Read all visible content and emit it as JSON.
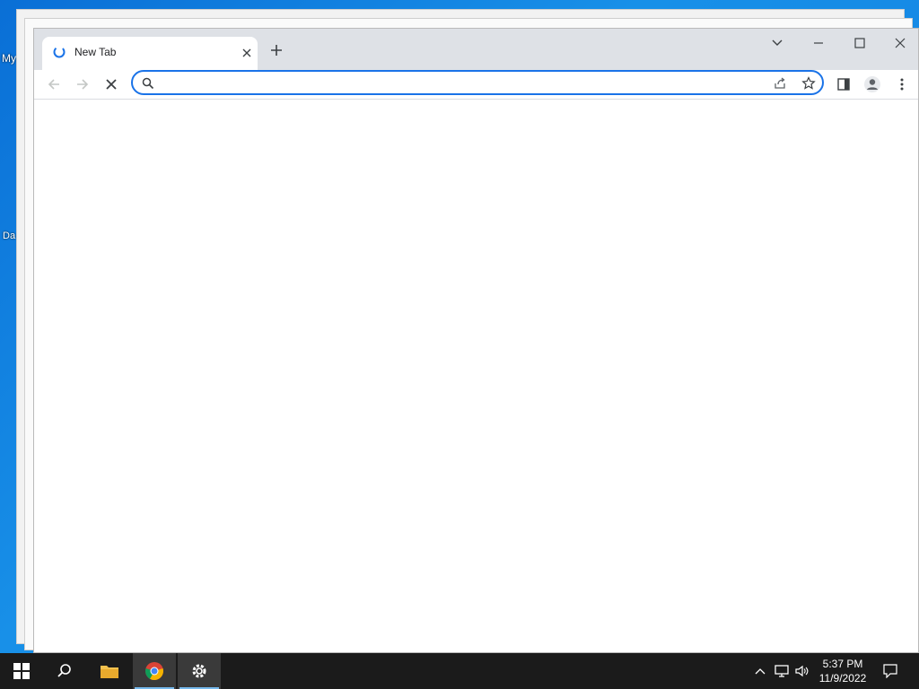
{
  "desktop": {
    "icon_label_1": "My",
    "icon_label_2": "Da"
  },
  "browser": {
    "tab": {
      "title": "New Tab"
    },
    "omnibox": {
      "value": "",
      "placeholder": ""
    },
    "colors": {
      "accent": "#1a73e8",
      "tabstrip": "#dee1e6"
    }
  },
  "taskbar": {
    "clock_time": "5:37 PM",
    "clock_date": "11/9/2022",
    "apps": [
      "start-icon",
      "search-icon",
      "file-explorer-icon",
      "chrome-icon",
      "settings-icon"
    ]
  }
}
